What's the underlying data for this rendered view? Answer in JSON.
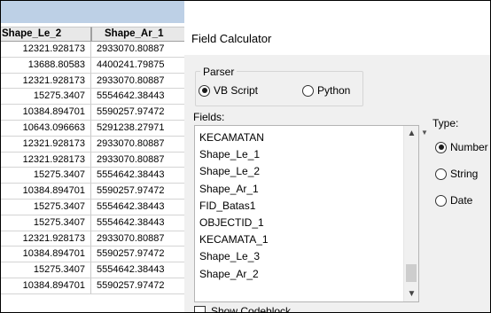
{
  "table": {
    "columns": [
      "Shape_Le_2",
      "Shape_Ar_1"
    ],
    "rows": [
      [
        "12321.928173",
        "2933070.80887"
      ],
      [
        "13688.80583",
        "4400241.79875"
      ],
      [
        "12321.928173",
        "2933070.80887"
      ],
      [
        "15275.3407",
        "5554642.38443"
      ],
      [
        "10384.894701",
        "5590257.97472"
      ],
      [
        "10643.096663",
        "5291238.27971"
      ],
      [
        "12321.928173",
        "2933070.80887"
      ],
      [
        "12321.928173",
        "2933070.80887"
      ],
      [
        "15275.3407",
        "5554642.38443"
      ],
      [
        "10384.894701",
        "5590257.97472"
      ],
      [
        "15275.3407",
        "5554642.38443"
      ],
      [
        "15275.3407",
        "5554642.38443"
      ],
      [
        "12321.928173",
        "2933070.80887"
      ],
      [
        "10384.894701",
        "5590257.97472"
      ],
      [
        "15275.3407",
        "5554642.38443"
      ],
      [
        "10384.894701",
        "5590257.97472"
      ]
    ]
  },
  "dialog": {
    "title": "Field Calculator",
    "parser": {
      "legend": "Parser",
      "options": [
        {
          "label": "VB Script",
          "selected": true
        },
        {
          "label": "Python",
          "selected": false
        }
      ]
    },
    "fields_label": "Fields:",
    "fields": [
      "KECAMATAN",
      "Shape_Le_1",
      "Shape_Le_2",
      "Shape_Ar_1",
      "FID_Batas1",
      "OBJECTID_1",
      "KECAMATA_1",
      "Shape_Le_3",
      "Shape_Ar_2"
    ],
    "type_label": "Type:",
    "types": [
      {
        "label": "Number",
        "selected": true
      },
      {
        "label": "String",
        "selected": false
      },
      {
        "label": "Date",
        "selected": false
      }
    ],
    "codeblock_label": "Show Codeblock",
    "scroll_up_icon": "▲",
    "scroll_down_icon": "▼"
  }
}
